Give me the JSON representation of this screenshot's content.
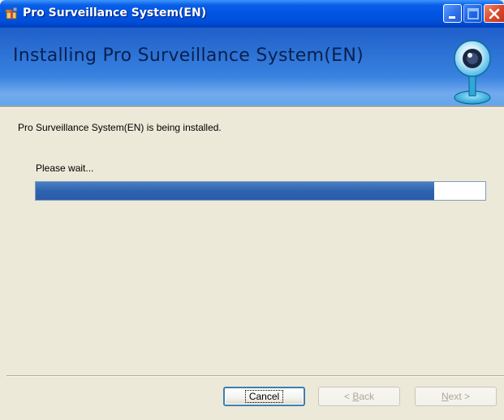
{
  "window": {
    "title": "Pro Surveillance System(EN)"
  },
  "banner": {
    "title": "Installing Pro Surveillance System(EN)",
    "icon": "webcam-icon"
  },
  "body": {
    "status_text": "Pro Surveillance System(EN) is being installed.",
    "wait_text": "Please wait...",
    "progress_fraction": 0.887
  },
  "buttons": {
    "cancel_label": "Cancel",
    "back": {
      "prefix": "< ",
      "mnemonic": "B",
      "rest": "ack"
    },
    "next": {
      "prefix": "",
      "mnemonic": "N",
      "rest": "ext >"
    }
  },
  "colors": {
    "titlebar": "#0055e5",
    "banner": "#2f76d8",
    "progress_fill": "#2e63b0",
    "background": "#ece9d8"
  }
}
